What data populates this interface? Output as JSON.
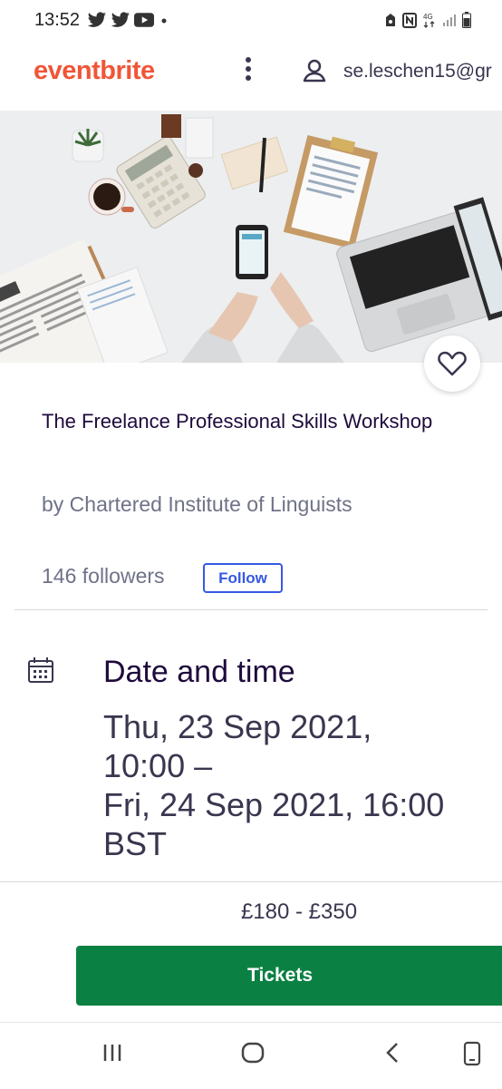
{
  "status_bar": {
    "time": "13:52",
    "left_icons": [
      "twitter-icon",
      "twitter-icon",
      "youtube-icon",
      "dot-icon"
    ],
    "right_icons": [
      "alarm-icon",
      "nfc-icon",
      "4g-icon",
      "signal-icon",
      "battery-icon"
    ],
    "network": "4G"
  },
  "header": {
    "logo": "eventbrite",
    "menu_icon": "kebab-menu-icon",
    "user_icon": "user-icon",
    "user_email": "se.leschen15@gr"
  },
  "event": {
    "title": "The Freelance Professional Skills Workshop",
    "organizer": "by Chartered Institute of Linguists",
    "followers": "146 followers",
    "follow_label": "Follow"
  },
  "date_section": {
    "icon": "calendar-icon",
    "heading": "Date and time",
    "line1": "Thu, 23 Sep 2021,",
    "line2": "10:00 –",
    "line3": "Fri, 24 Sep 2021, 16:00",
    "line4": "BST"
  },
  "footer": {
    "price": "£180 - £350",
    "tickets_label": "Tickets"
  },
  "nav": [
    "recent-apps-icon",
    "home-icon",
    "back-icon",
    "rotate-icon"
  ],
  "colors": {
    "brand": "#f05537",
    "title": "#1e0a3c",
    "follow": "#3659e3",
    "tickets": "#0b8043"
  }
}
